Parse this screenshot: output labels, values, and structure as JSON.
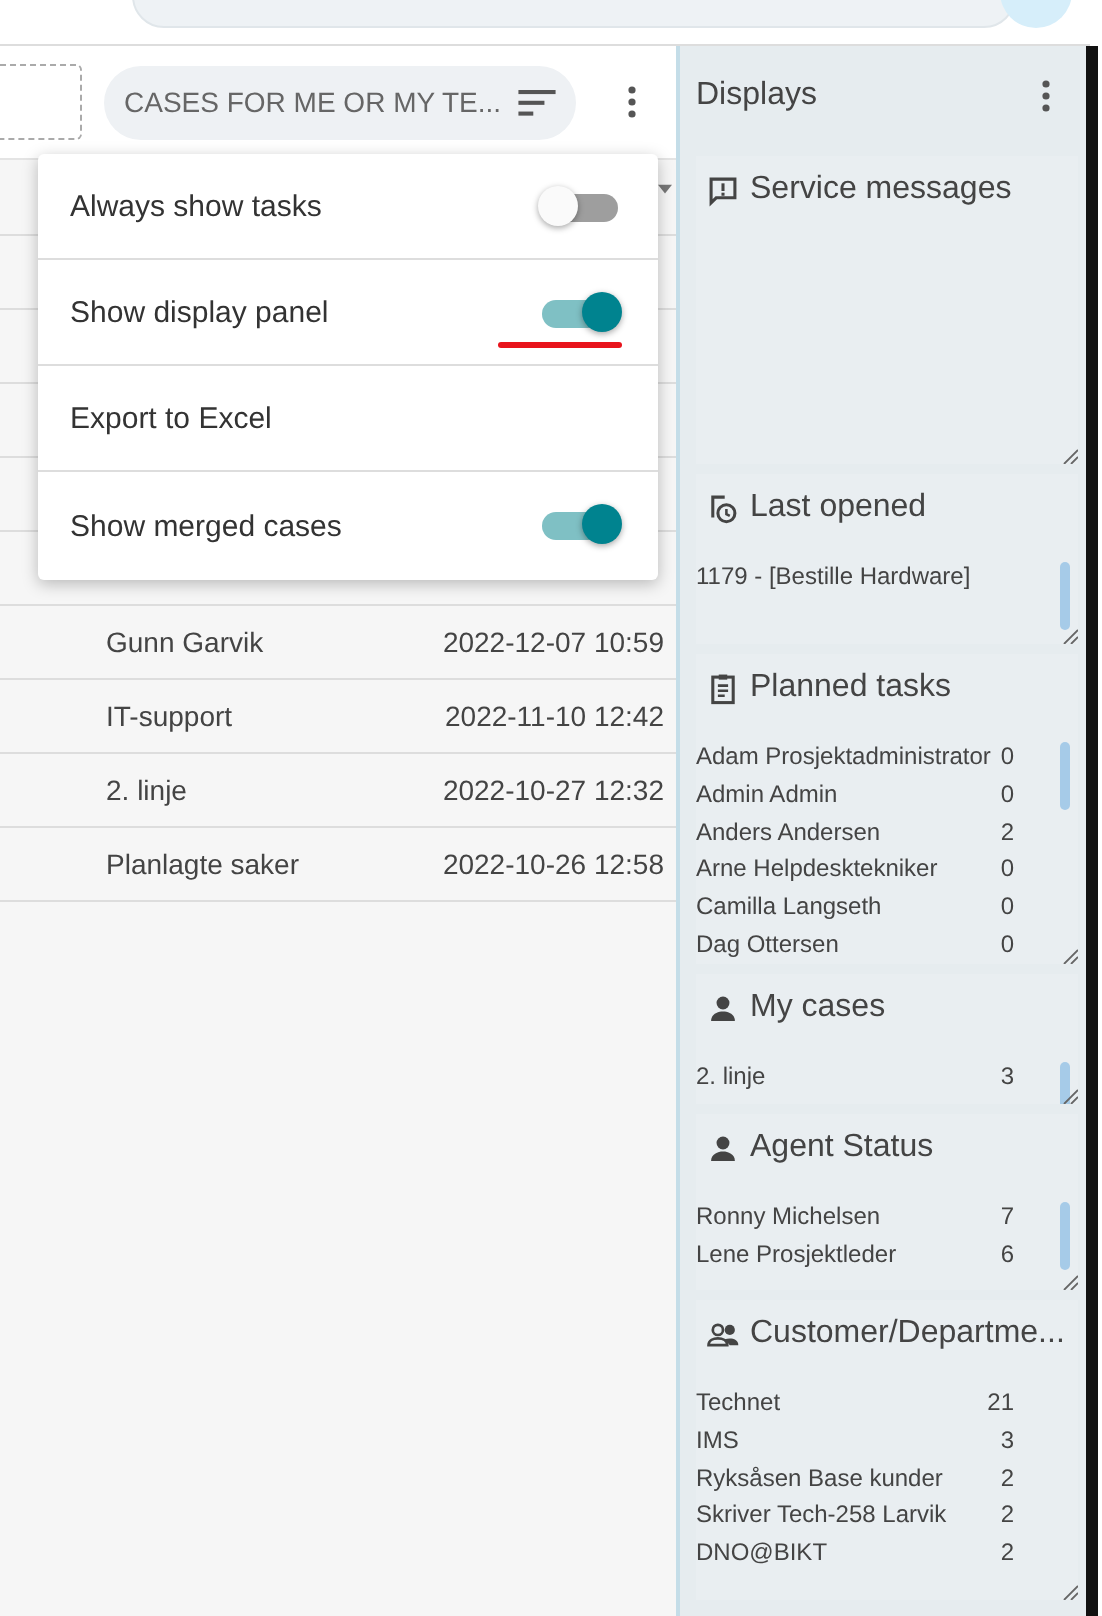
{
  "toolbar": {
    "filter_label": "CASES FOR ME OR MY TE..."
  },
  "menu": [
    {
      "label": "Always show tasks",
      "kind": "toggle",
      "on": false,
      "underlined": false
    },
    {
      "label": "Show display panel",
      "kind": "toggle",
      "on": true,
      "underlined": true
    },
    {
      "label": "Export to Excel",
      "kind": "action"
    },
    {
      "label": "Show merged cases",
      "kind": "toggle",
      "on": true,
      "underlined": false
    }
  ],
  "table": {
    "rows": [
      {
        "team": "Gunn Garvik",
        "date": "2022-12-07 10:59"
      },
      {
        "team": "IT-support",
        "date": "2022-11-10 12:42"
      },
      {
        "team": "2. linje",
        "date": "2022-10-27 12:32"
      },
      {
        "team": "Planlagte saker",
        "date": "2022-10-26 12:58"
      }
    ]
  },
  "panel": {
    "title": "Displays",
    "widgets": [
      {
        "kind": "messages",
        "title": "Service messages"
      },
      {
        "kind": "recent",
        "title": "Last opened",
        "rows": [
          {
            "name": "1179 - [Bestille Hardware]"
          }
        ]
      },
      {
        "kind": "tasks",
        "title": "Planned tasks",
        "rows": [
          {
            "name": "Adam Prosjektadministrator",
            "count": "0"
          },
          {
            "name": "Admin Admin",
            "count": "0"
          },
          {
            "name": "Anders Andersen",
            "count": "2"
          },
          {
            "name": "Arne Helpdesktekniker",
            "count": "0"
          },
          {
            "name": "Camilla Langseth",
            "count": "0"
          },
          {
            "name": "Dag Ottersen",
            "count": "0"
          }
        ]
      },
      {
        "kind": "person",
        "title": "My cases",
        "rows": [
          {
            "name": "2. linje",
            "count": "3"
          }
        ]
      },
      {
        "kind": "person",
        "title": "Agent Status",
        "rows": [
          {
            "name": "Ronny Michelsen",
            "count": "7"
          },
          {
            "name": "Lene Prosjektleder",
            "count": "6"
          }
        ]
      },
      {
        "kind": "group",
        "title": "Customer/Departme...",
        "rows": [
          {
            "name": "Technet",
            "count": "21"
          },
          {
            "name": "IMS",
            "count": "3"
          },
          {
            "name": "Ryksåsen Base kunder",
            "count": "2"
          },
          {
            "name": "Skriver Tech-258 Larvik",
            "count": "2"
          },
          {
            "name": "DNO@BIKT",
            "count": "2"
          }
        ]
      }
    ]
  }
}
